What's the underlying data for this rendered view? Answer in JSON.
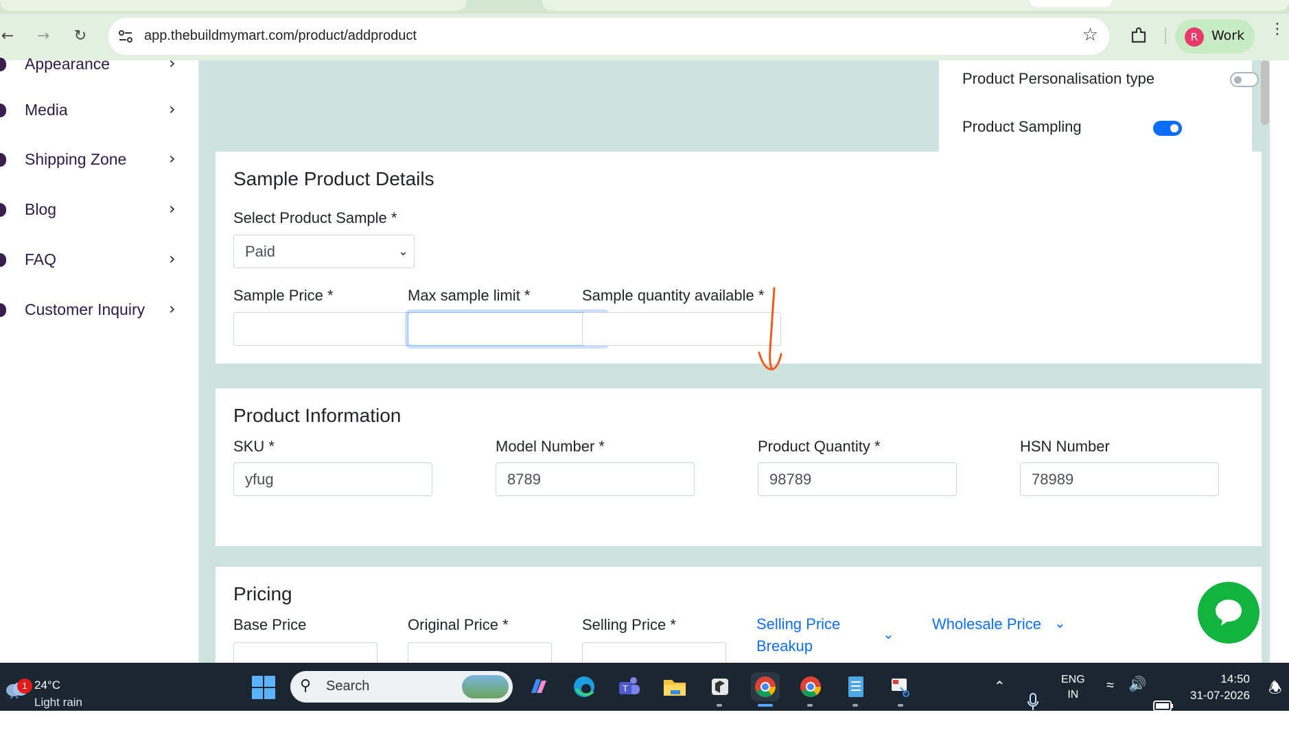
{
  "browser": {
    "url": "app.thebuildmymart.com/product/addproduct",
    "profile_initial": "R",
    "profile_label": "Work"
  },
  "sidebar": {
    "items": [
      {
        "label": "Appearance"
      },
      {
        "label": "Media"
      },
      {
        "label": "Shipping Zone"
      },
      {
        "label": "Blog"
      },
      {
        "label": "FAQ"
      },
      {
        "label": "Customer Inquiry"
      }
    ]
  },
  "settings_card": {
    "personalisation_label": "Product Personalisation type",
    "personalisation_on": false,
    "sampling_label": "Product Sampling",
    "sampling_on": true
  },
  "sample_details": {
    "title": "Sample Product Details",
    "select_label": "Select Product Sample *",
    "select_value": "Paid",
    "price_label": "Sample Price *",
    "price_value": "",
    "max_limit_label": "Max sample limit *",
    "max_limit_value": "",
    "qty_available_label": "Sample quantity available *",
    "qty_available_value": ""
  },
  "product_info": {
    "title": "Product Information",
    "sku_label": "SKU *",
    "sku_value": "yfug",
    "model_label": "Model Number *",
    "model_value": "8789",
    "quantity_label": "Product Quantity *",
    "quantity_value": "98789",
    "hsn_label": "HSN Number",
    "hsn_value": "78989"
  },
  "pricing": {
    "title": "Pricing",
    "base_label": "Base Price",
    "original_label": "Original Price *",
    "selling_label": "Selling Price *",
    "breakup_label_line1": "Selling Price",
    "breakup_label_line2": "Breakup",
    "wholesale_label": "Wholesale Price"
  },
  "taskbar": {
    "notification_count": "1",
    "temperature": "24°C",
    "weather": "Light rain",
    "search_placeholder": "Search",
    "lang_line1": "ENG",
    "lang_line2": "IN",
    "time": "14:50",
    "date": "31-07-2026"
  },
  "colors": {
    "accent": "#0d6efd",
    "sidebar_text": "#2a1b47",
    "main_bg": "#cfe3de",
    "chat_green": "#12b33f",
    "annotation": "#f05a1a"
  }
}
